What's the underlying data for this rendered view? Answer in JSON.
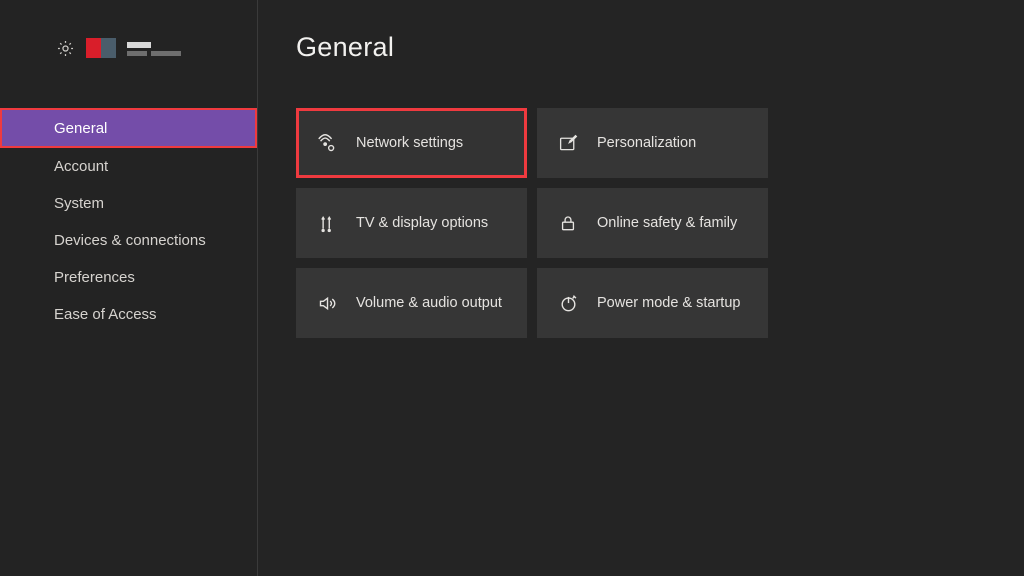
{
  "page_title": "General",
  "sidebar": {
    "items": [
      {
        "label": "General",
        "selected": true
      },
      {
        "label": "Account"
      },
      {
        "label": "System"
      },
      {
        "label": "Devices & connections"
      },
      {
        "label": "Preferences"
      },
      {
        "label": "Ease of Access"
      }
    ]
  },
  "tiles": [
    {
      "label": "Network settings",
      "icon": "network",
      "highlight": true
    },
    {
      "label": "Personalization",
      "icon": "personalize"
    },
    {
      "label": "TV & display options",
      "icon": "display"
    },
    {
      "label": "Online safety & family",
      "icon": "lock"
    },
    {
      "label": "Volume & audio output",
      "icon": "audio"
    },
    {
      "label": "Power mode & startup",
      "icon": "power"
    }
  ]
}
